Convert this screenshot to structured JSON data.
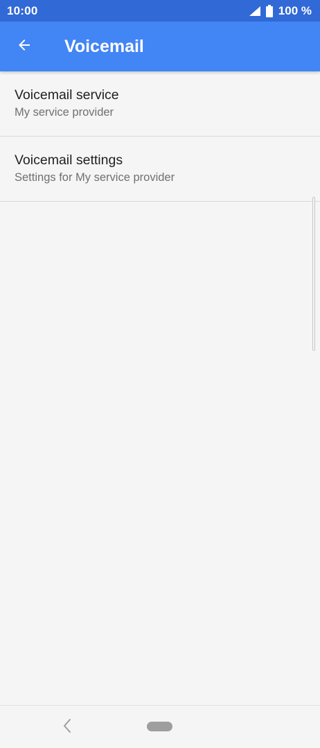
{
  "status_bar": {
    "time": "10:00",
    "battery": "100 %",
    "icons": [
      "signal-icon",
      "battery-icon"
    ]
  },
  "app_bar": {
    "title": "Voicemail",
    "back_icon": "arrow-back-icon"
  },
  "list": {
    "items": [
      {
        "title": "Voicemail service",
        "subtitle": "My service provider"
      },
      {
        "title": "Voicemail settings",
        "subtitle": "Settings for My service provider"
      }
    ]
  },
  "nav_bar": {
    "icons": [
      "nav-back-icon",
      "home-pill"
    ]
  },
  "colors": {
    "status_bar": "#3169d6",
    "app_bar": "#4285f4",
    "background": "#f5f5f5"
  }
}
